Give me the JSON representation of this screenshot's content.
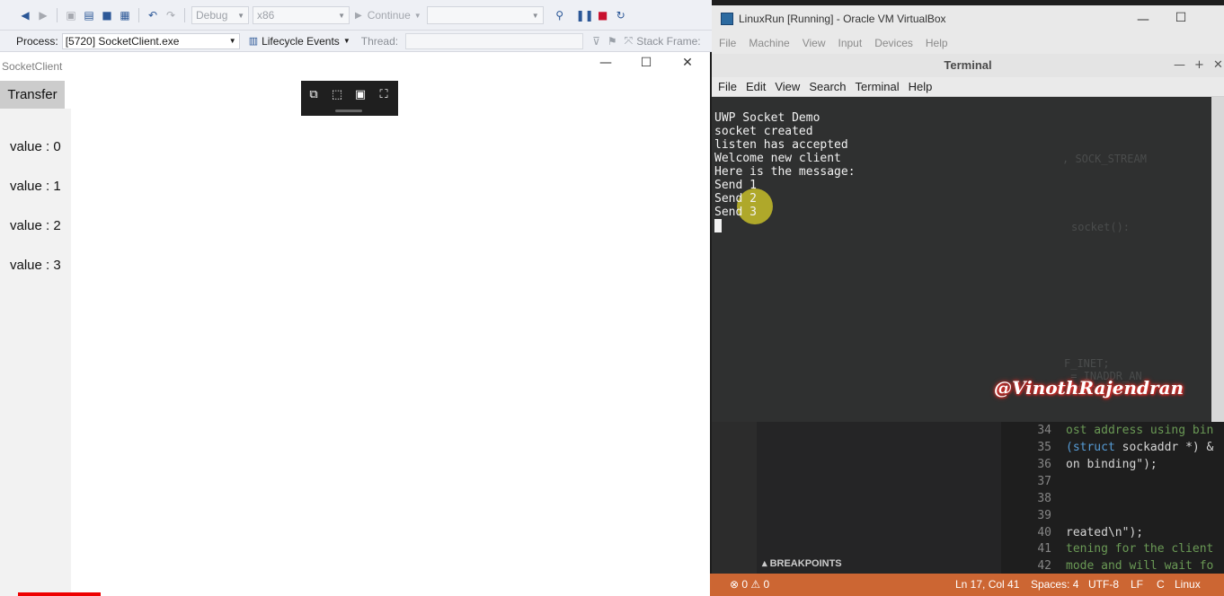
{
  "vs": {
    "toolbar": {
      "config": "Debug",
      "platform": "x86",
      "continue_label": "Continue"
    },
    "debug_bar": {
      "process_label": "Process:",
      "process_value": "[5720] SocketClient.exe",
      "lifecycle_label": "Lifecycle Events",
      "thread_label": "Thread:",
      "stackframe_label": "Stack Frame:"
    }
  },
  "app": {
    "title": "SocketClient",
    "transfer_label": "Transfer",
    "values": [
      "value : 0",
      "value : 1",
      "value : 2",
      "value : 3"
    ]
  },
  "vbox": {
    "title": "LinuxRun [Running] - Oracle VM VirtualBox",
    "menu": [
      "File",
      "Machine",
      "View",
      "Input",
      "Devices",
      "Help"
    ]
  },
  "terminal": {
    "title": "Terminal",
    "menu": [
      "File",
      "Edit",
      "View",
      "Search",
      "Terminal",
      "Help"
    ],
    "lines": [
      "UWP Socket Demo",
      "socket created",
      "listen has accepted",
      "Welcome new client",
      "Here is the message:",
      "Send 1",
      "Send 2",
      "Send 3"
    ],
    "watermark": "@VinothRajendran"
  },
  "vscode": {
    "panel_title": "BREAKPOINTS",
    "line_numbers": [
      "34",
      "35",
      "36",
      "37",
      "38",
      "39",
      "40",
      "41",
      "42"
    ],
    "code": {
      "l34": "ost address using bin",
      "l35_kw": "(struct",
      "l35_rest": " sockaddr *) &",
      "l36": "on binding\");",
      "l40": "reated\\n\");",
      "l41": "tening for the client",
      "l42": "mode and will wait fo"
    },
    "status": {
      "errors": "⊗ 0  ⚠ 0",
      "position": "Ln 17, Col 41",
      "spaces": "Spaces: 4",
      "encoding": "UTF-8",
      "eol": "LF",
      "lang": "C",
      "os": "Linux"
    }
  }
}
